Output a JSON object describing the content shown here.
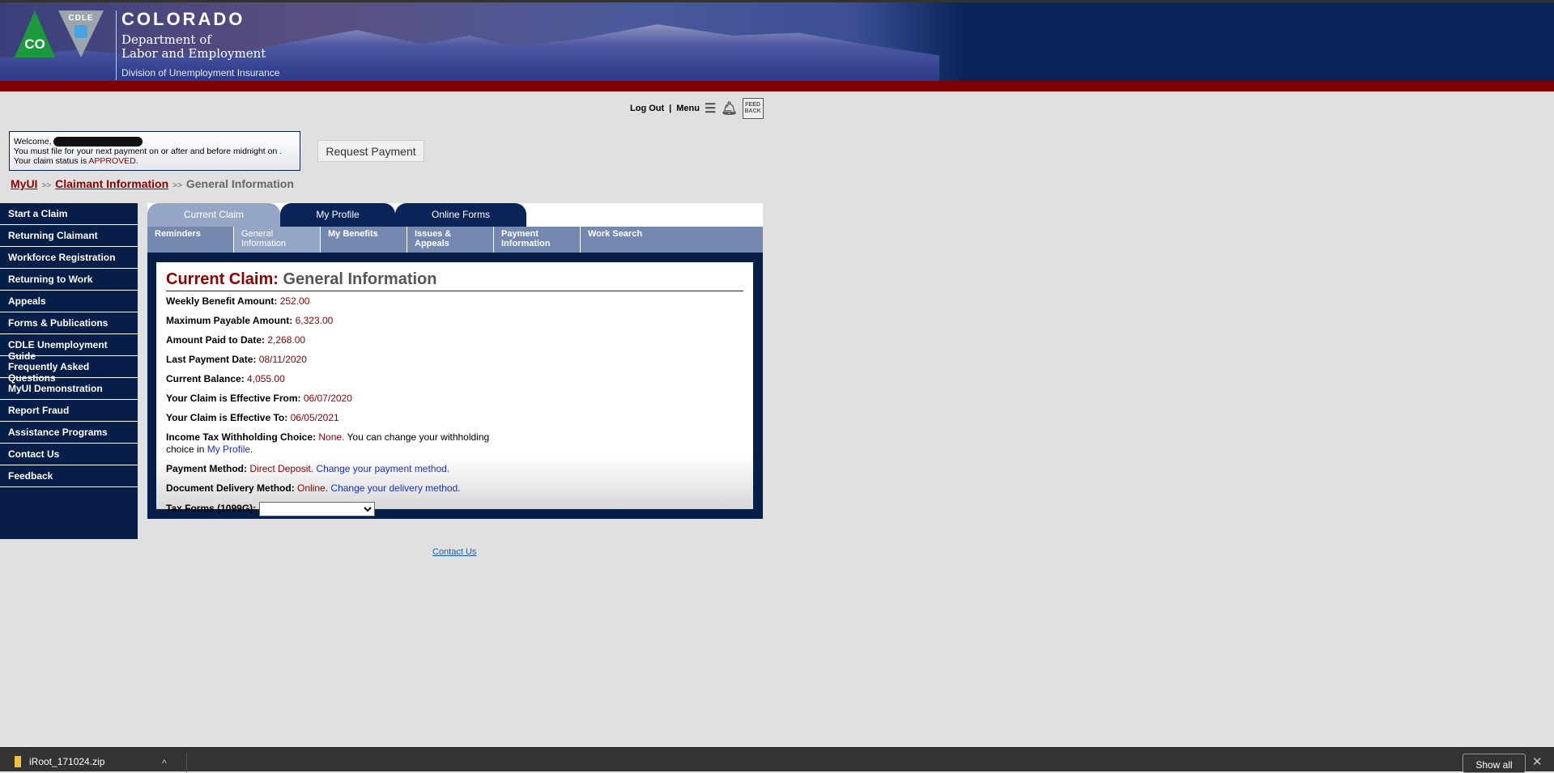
{
  "header": {
    "state": "COLORADO",
    "dept_line1": "Department of",
    "dept_line2": "Labor and Employment",
    "division": "Division of Unemployment Insurance",
    "logo_co": "CO",
    "logo_cdle": "CDLE"
  },
  "util": {
    "logout": "Log Out",
    "sep": "|",
    "menu": "Menu",
    "feedback_icon_text": "FEED BACK"
  },
  "welcome": {
    "greeting": "Welcome,",
    "line2": "You must file for your next payment on or after and before midnight on .",
    "status_prefix": "Your claim status is ",
    "status": "APPROVED",
    "status_suffix": "."
  },
  "request_payment": "Request Payment",
  "breadcrumb": {
    "items": [
      "MyUI",
      "Claimant Information"
    ],
    "current": "General Information",
    "sep": ">>"
  },
  "sidebar": {
    "items": [
      "Start a Claim",
      "Returning Claimant",
      "Workforce Registration",
      "Returning to Work",
      "Appeals",
      "Forms & Publications",
      "CDLE Unemployment Guide",
      "Frequently Asked Questions",
      "MyUI Demonstration",
      "Report Fraud",
      "Assistance Programs",
      "Contact Us",
      "Feedback"
    ]
  },
  "tabs": [
    "Current Claim",
    "My Profile",
    "Online Forms"
  ],
  "subnav": [
    "Reminders",
    "General Information",
    "My Benefits",
    "Issues & Appeals",
    "Payment Information",
    "Work Search"
  ],
  "content": {
    "title_prefix": "Current Claim:",
    "title": " General Information",
    "fields": [
      {
        "label": "Weekly Benefit Amount:",
        "value": "252.00"
      },
      {
        "label": "Maximum Payable Amount:",
        "value": "6,323.00"
      },
      {
        "label": "Amount Paid to Date:",
        "value": "2,268.00"
      },
      {
        "label": "Last Payment Date:",
        "value": "08/11/2020"
      },
      {
        "label": "Current Balance:",
        "value": "4,055.00"
      },
      {
        "label": "Your Claim is Effective From:",
        "value": "06/07/2020"
      },
      {
        "label": "Your Claim is Effective To:",
        "value": "06/05/2021"
      }
    ],
    "tax": {
      "label": "Income Tax Withholding Choice:",
      "value": "None.",
      "text": " You can change your withholding choice in ",
      "link": "My Profile",
      "end": "."
    },
    "payment": {
      "label": "Payment Method:",
      "value": "Direct Deposit.",
      "link": "Change your payment method."
    },
    "delivery": {
      "label": "Document Delivery Method:",
      "value": "Online.",
      "link": "Change your delivery method."
    },
    "taxforms": {
      "label": "Tax Forms (1099G):",
      "selected": ""
    }
  },
  "footer": {
    "contact": "Contact Us"
  },
  "downloads": {
    "file": "iRoot_171024.zip",
    "show_all": "Show all"
  }
}
